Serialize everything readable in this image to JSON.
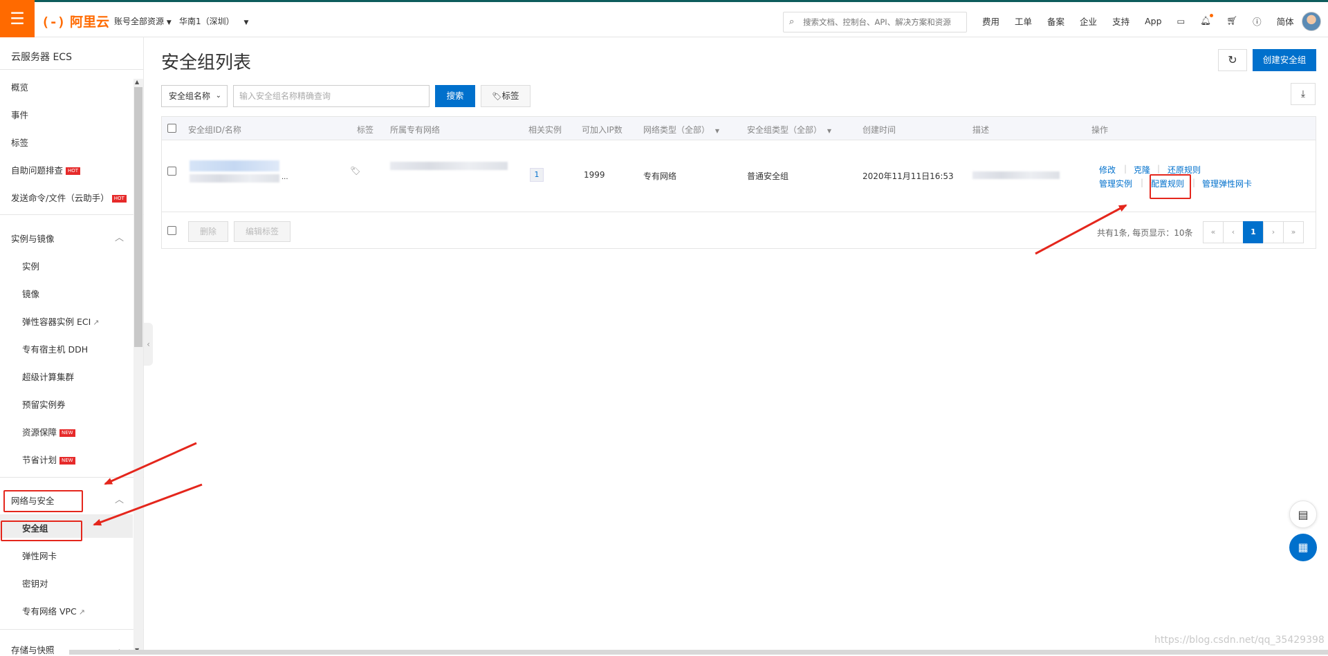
{
  "topbar": {
    "menu_icon": "☰",
    "logo_bracket": "(-)",
    "logo_text": "阿里云",
    "account_scope": "账号全部资源",
    "region": "华南1（深圳）",
    "search_placeholder": "搜索文档、控制台、API、解决方案和资源",
    "links": [
      "费用",
      "工单",
      "备案",
      "企业",
      "支持",
      "App"
    ],
    "lang": "简体"
  },
  "sidebar": {
    "title": "云服务器 ECS",
    "top_items": [
      "概览",
      "事件",
      "标签",
      "自助问题排查",
      "发送命令/文件（云助手）"
    ],
    "hot_badge": "HOT",
    "new_badge": "NEW",
    "group1": "实例与镜像",
    "group1_items": [
      "实例",
      "镜像",
      "弹性容器实例 ECI",
      "专有宿主机 DDH",
      "超级计算集群",
      "预留实例券",
      "资源保障",
      "节省计划"
    ],
    "group2": "网络与安全",
    "group2_items": [
      "安全组",
      "弹性网卡",
      "密钥对",
      "专有网络 VPC"
    ],
    "group3": "存储与快照"
  },
  "main": {
    "title": "安全组列表",
    "create_button": "创建安全组",
    "filter_select": "安全组名称",
    "search_placeholder": "输入安全组名称精确查询",
    "search_button": "搜索",
    "tag_button": "标签",
    "columns": [
      "安全组ID/名称",
      "标签",
      "所属专有网络",
      "相关实例",
      "可加入IP数",
      "网络类型（全部）",
      "安全组类型（全部）",
      "创建时间",
      "描述",
      "操作"
    ],
    "row": {
      "id_suffix": "...",
      "instances": "1",
      "ip_count": "1999",
      "network_type": "专有网络",
      "group_type": "普通安全组",
      "created": "2020年11月11日16:53",
      "actions": [
        "修改",
        "克隆",
        "还原规则",
        "管理实例",
        "配置规则",
        "管理弹性网卡"
      ]
    },
    "delete_button": "删除",
    "edit_tags_button": "编辑标签",
    "pager_info": "共有1条, 每页显示：10条",
    "pager": [
      "«",
      "‹",
      "1",
      "›",
      "»"
    ]
  },
  "watermark": "https://blog.csdn.net/qq_35429398",
  "colors": {
    "brand": "#ff6a00",
    "primary": "#0070cc",
    "annotation": "#e4261c"
  }
}
